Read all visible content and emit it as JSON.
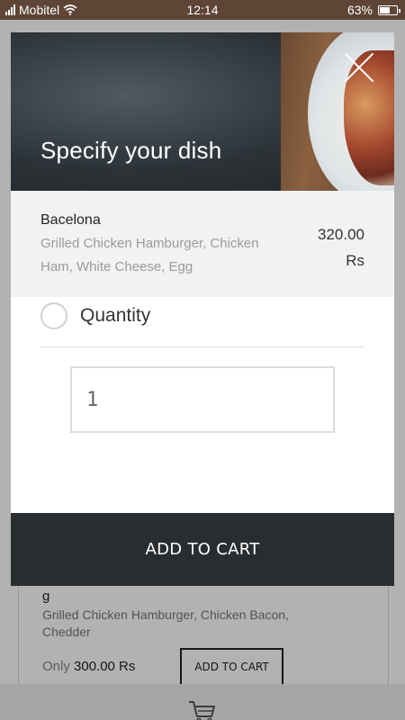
{
  "status_bar": {
    "carrier": "Mobitel",
    "time": "12:14",
    "battery_percent": "63%",
    "battery_level": 0.63
  },
  "background": {
    "item": {
      "title": "g",
      "description": "Grilled Chicken Hamburger, Chicken Bacon, Chedder",
      "price_prefix": "Only",
      "price": "300.00 Rs",
      "button_label": "ADD TO CART"
    },
    "cart_icon": "cart-icon"
  },
  "modal": {
    "heading": "Specify your dish",
    "close_icon": "close-icon",
    "dish": {
      "name": "Bacelona",
      "description": "Grilled Chicken Hamburger, Chicken Ham, White Cheese, Egg",
      "price": "320.00 Rs"
    },
    "option": {
      "label": "Quantity",
      "checked": false
    },
    "quantity_value": "1",
    "add_button_label": "ADD TO CART"
  },
  "colors": {
    "status_bar": "#5e4536",
    "add_button": "#2a2d30",
    "dish_panel": "#f1f3f2"
  }
}
